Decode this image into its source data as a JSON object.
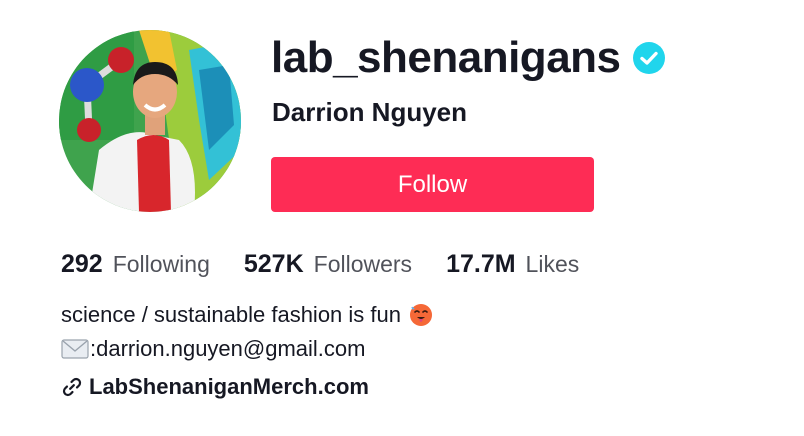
{
  "profile": {
    "username": "lab_shenanigans",
    "display_name": "Darrion Nguyen",
    "verified": true,
    "follow_label": "Follow"
  },
  "stats": [
    {
      "value": "292",
      "label": "Following"
    },
    {
      "value": "527K",
      "label": "Followers"
    },
    {
      "value": "17.7M",
      "label": "Likes"
    }
  ],
  "bio": {
    "line1": "science / sustainable fashion is fun",
    "line1_emoji": "hot-face-emoji",
    "line2_prefix": ": ",
    "line2_email": "darrion.nguyen@gmail.com",
    "line2_icon": "envelope-icon"
  },
  "link": {
    "icon": "link-icon",
    "text": "LabShenaniganMerch.com"
  },
  "colors": {
    "follow_button": "#fe2c55",
    "verified_badge": "#20d5ec",
    "text_primary": "#161823"
  }
}
